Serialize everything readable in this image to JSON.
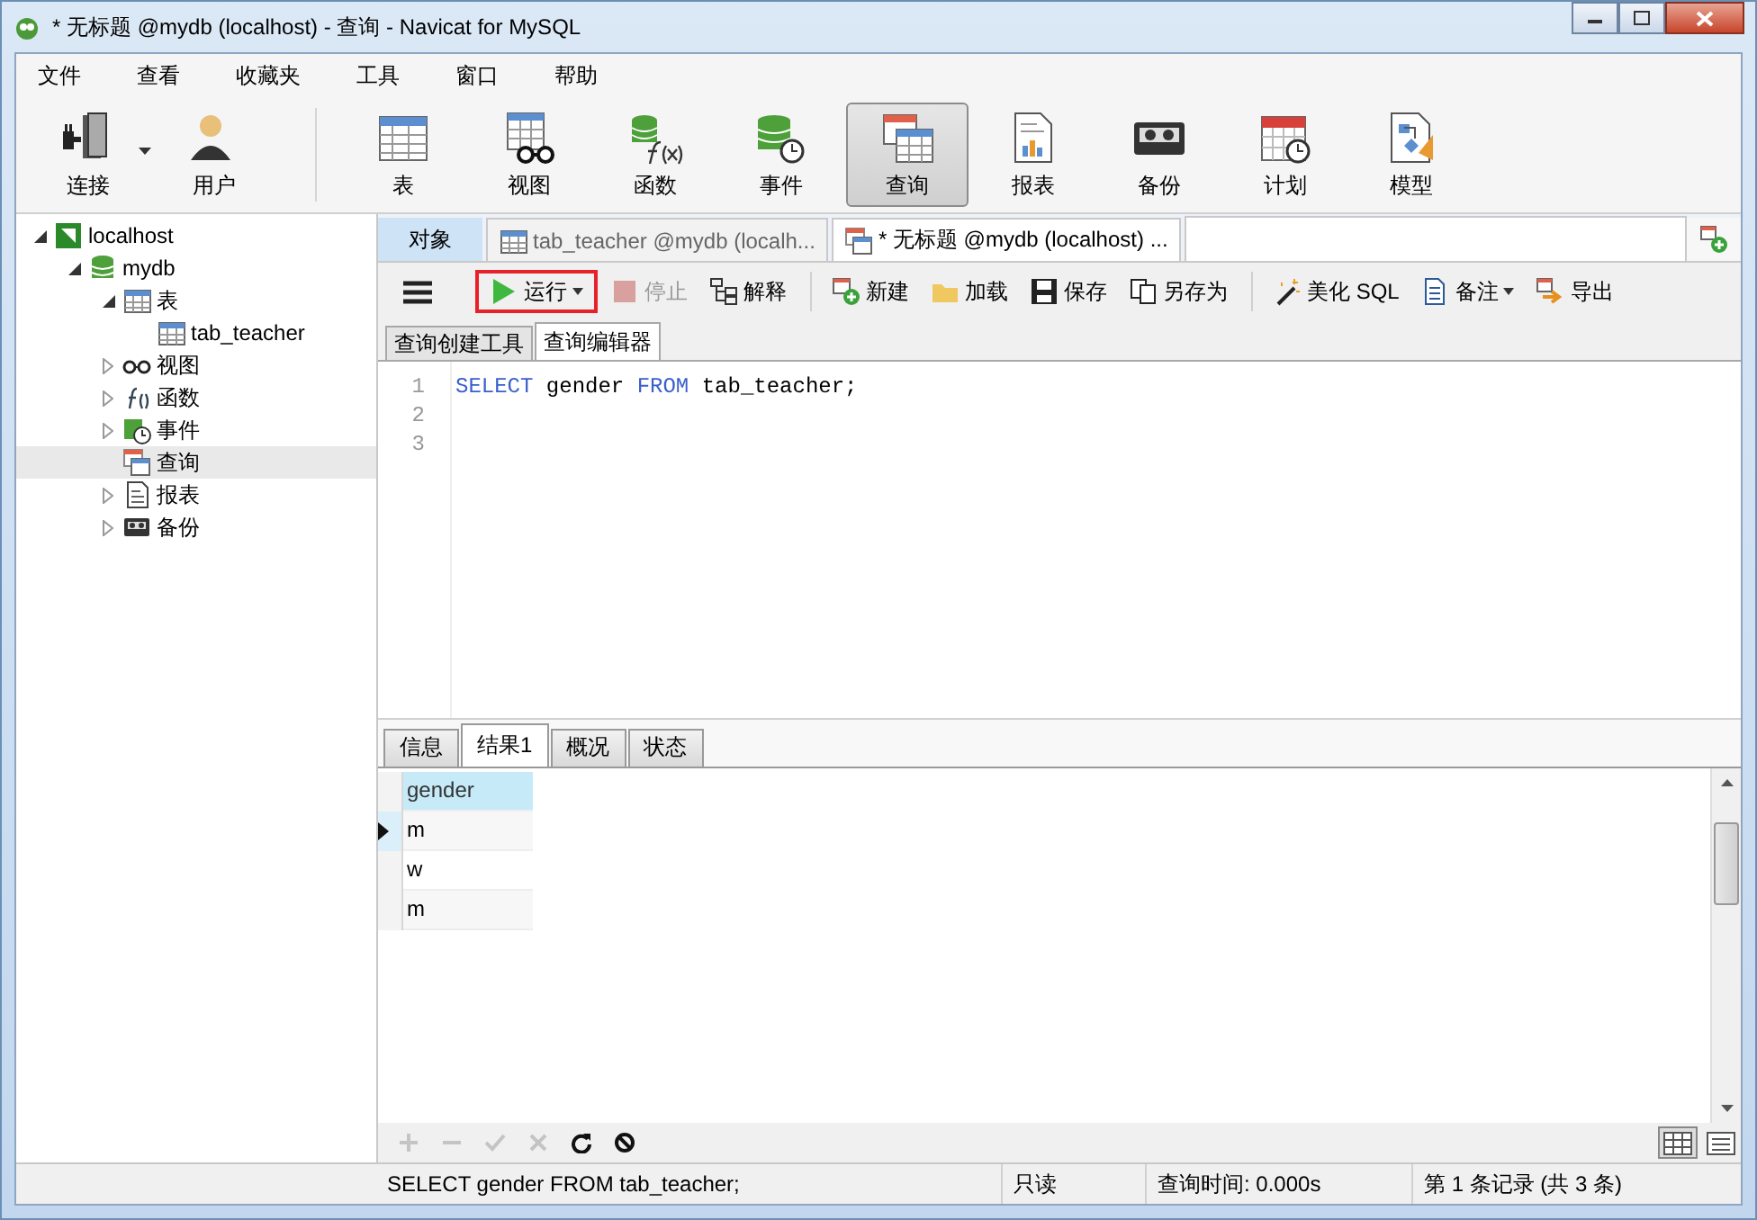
{
  "window": {
    "title": "* 无标题 @mydb (localhost) - 查询 - Navicat for MySQL"
  },
  "menu": [
    "文件",
    "查看",
    "收藏夹",
    "工具",
    "窗口",
    "帮助"
  ],
  "toolbar": [
    {
      "label": "连接",
      "selected": false,
      "dropdown": true
    },
    {
      "label": "用户",
      "selected": false,
      "dropdown": false
    },
    {
      "label": "表",
      "selected": false,
      "dropdown": false
    },
    {
      "label": "视图",
      "selected": false,
      "dropdown": false
    },
    {
      "label": "函数",
      "selected": false,
      "dropdown": false
    },
    {
      "label": "事件",
      "selected": false,
      "dropdown": false
    },
    {
      "label": "查询",
      "selected": true,
      "dropdown": false
    },
    {
      "label": "报表",
      "selected": false,
      "dropdown": false
    },
    {
      "label": "备份",
      "selected": false,
      "dropdown": false
    },
    {
      "label": "计划",
      "selected": false,
      "dropdown": false
    },
    {
      "label": "模型",
      "selected": false,
      "dropdown": false
    }
  ],
  "sidebar": {
    "items": [
      {
        "label": "localhost",
        "expanded": true,
        "selected": false,
        "children": [
          {
            "label": "mydb",
            "expanded": true,
            "selected": false,
            "children": [
              {
                "label": "表",
                "expanded": true,
                "selected": false,
                "children": [
                  {
                    "label": "tab_teacher",
                    "selected": false
                  }
                ]
              },
              {
                "label": "视图",
                "expanded": false,
                "selected": false
              },
              {
                "label": "函数",
                "expanded": false,
                "selected": false
              },
              {
                "label": "事件",
                "expanded": false,
                "selected": false
              },
              {
                "label": "查询",
                "selected": true
              },
              {
                "label": "报表",
                "expanded": false,
                "selected": false
              },
              {
                "label": "备份",
                "expanded": false,
                "selected": false
              }
            ]
          }
        ]
      }
    ]
  },
  "tabs": [
    {
      "label": "对象",
      "kind": "object",
      "selected": false
    },
    {
      "label": "tab_teacher @mydb (localh...",
      "kind": "table",
      "selected": false
    },
    {
      "label": "* 无标题 @mydb (localhost) ...",
      "kind": "query",
      "selected": true
    }
  ],
  "editor_toolbar": [
    [
      {
        "label": "运行",
        "dropdown": true,
        "disabled": false,
        "highlighted": true
      }
    ],
    [
      {
        "label": "停止",
        "dropdown": false,
        "disabled": true,
        "highlighted": false
      },
      {
        "label": "解释",
        "dropdown": false,
        "disabled": false,
        "highlighted": false
      }
    ],
    [
      {
        "label": "新建",
        "dropdown": false,
        "disabled": false,
        "highlighted": false
      },
      {
        "label": "加载",
        "dropdown": false,
        "disabled": false,
        "highlighted": false
      },
      {
        "label": "保存",
        "dropdown": false,
        "disabled": false,
        "highlighted": false
      },
      {
        "label": "另存为",
        "dropdown": false,
        "disabled": false,
        "highlighted": false
      }
    ],
    [
      {
        "label": "美化 SQL",
        "dropdown": false,
        "disabled": false,
        "highlighted": false
      },
      {
        "label": "备注",
        "dropdown": true,
        "disabled": false,
        "highlighted": false
      },
      {
        "label": "导出",
        "dropdown": false,
        "disabled": false,
        "highlighted": false
      }
    ]
  ],
  "sub_tabs": [
    {
      "label": "查询创建工具",
      "selected": false
    },
    {
      "label": "查询编辑器",
      "selected": true
    }
  ],
  "editor": {
    "lines": [
      {
        "number": "1",
        "tokens": [
          {
            "text": "SELECT",
            "kind": "keyword"
          },
          {
            "text": " gender ",
            "kind": "plain"
          },
          {
            "text": "FROM",
            "kind": "keyword"
          },
          {
            "text": " tab_teacher;",
            "kind": "plain"
          }
        ]
      },
      {
        "number": "2"
      },
      {
        "number": "3"
      }
    ]
  },
  "result_tabs": [
    {
      "label": "信息",
      "selected": false
    },
    {
      "label": "结果1",
      "selected": true
    },
    {
      "label": "概况",
      "selected": false
    },
    {
      "label": "状态",
      "selected": false
    }
  ],
  "grid": {
    "columns": [
      "gender"
    ],
    "rows": [
      {
        "cells": [
          "m"
        ],
        "selected": true
      },
      {
        "cells": [
          "w"
        ],
        "selected": false
      },
      {
        "cells": [
          "m"
        ],
        "selected": false
      }
    ]
  },
  "grid_toolbar": [
    {
      "kind": "add",
      "disabled": true
    },
    {
      "kind": "delete",
      "disabled": true
    },
    {
      "kind": "apply",
      "disabled": true
    },
    {
      "kind": "cancel",
      "disabled": true
    },
    {
      "kind": "refresh",
      "disabled": false
    },
    {
      "kind": "stop",
      "disabled": false
    }
  ],
  "view_modes": [
    {
      "kind": "grid",
      "selected": true
    },
    {
      "kind": "form",
      "selected": false
    }
  ],
  "status_bar": [
    "SELECT gender FROM tab_teacher;",
    "只读",
    "查询时间: 0.000s",
    "第 1 条记录 (共 3 条)"
  ]
}
